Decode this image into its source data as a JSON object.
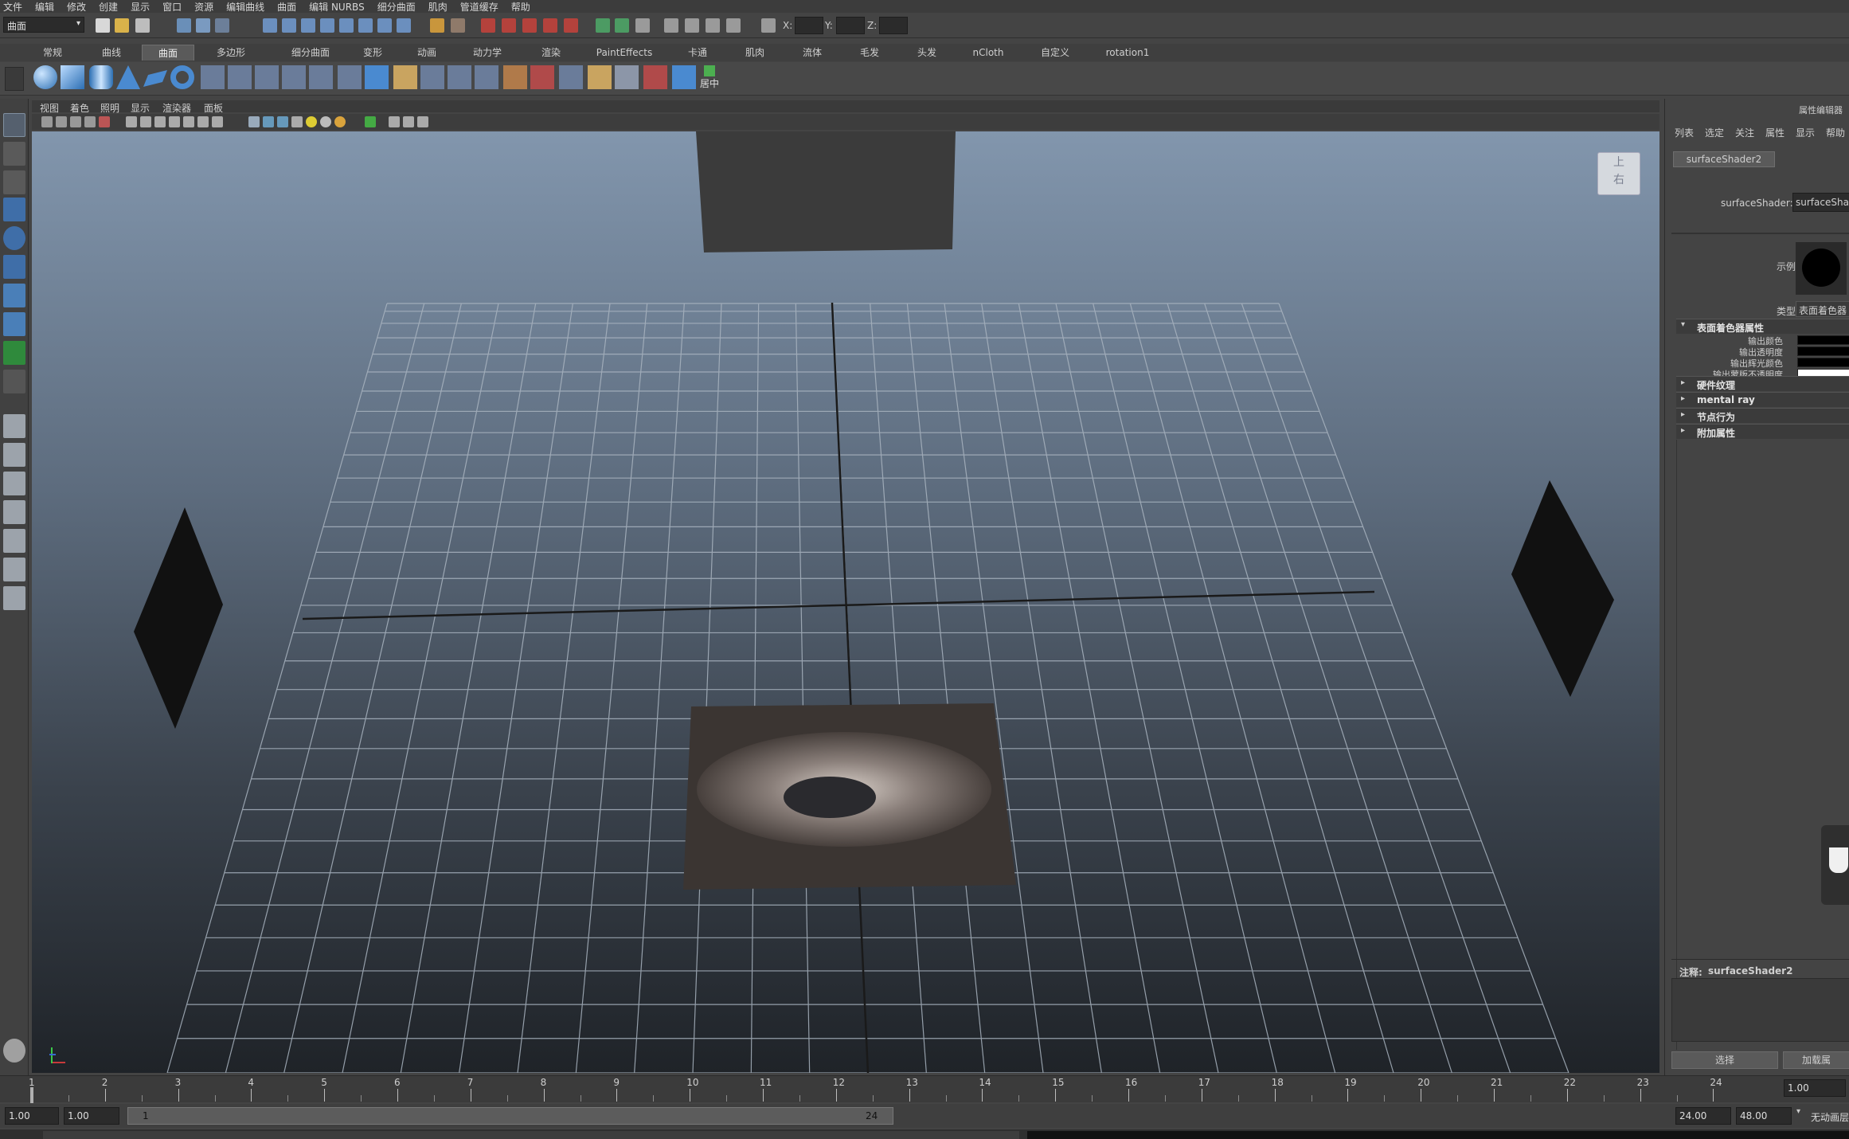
{
  "menubar": {
    "items": [
      "文件",
      "编辑",
      "修改",
      "创建",
      "显示",
      "窗口",
      "资源",
      "编辑曲线",
      "曲面",
      "编辑 NURBS",
      "细分曲面",
      "肌肉",
      "管道缓存",
      "帮助"
    ]
  },
  "statusline": {
    "menuset": "曲面",
    "x_label": "X:",
    "y_label": "Y:",
    "z_label": "Z:"
  },
  "shelf": {
    "tabs": [
      "常规",
      "曲线",
      "曲面",
      "多边形",
      "细分曲面",
      "变形",
      "动画",
      "动力学",
      "渲染",
      "PaintEffects",
      "卡通",
      "肌肉",
      "流体",
      "毛发",
      "头发",
      "nCloth",
      "自定义",
      "rotation1"
    ],
    "active_tab": "曲面",
    "last_icon_label": "居中"
  },
  "viewport": {
    "menu": [
      "视图",
      "着色",
      "照明",
      "显示",
      "渲染器",
      "面板"
    ],
    "viewcube_top": "上",
    "viewcube_side": "右",
    "colors": {
      "sky_top": "#8296ad",
      "floor": "#1f2328",
      "grid": "#a9b4c0"
    }
  },
  "attribute_editor": {
    "title": "属性编辑器",
    "menu": [
      "列表",
      "选定",
      "关注",
      "属性",
      "显示",
      "帮助"
    ],
    "node_tab": "surfaceShader2",
    "node_label": "surfaceShader:",
    "node_value": "surfaceShade",
    "sample_label": "示例",
    "type_label": "类型",
    "type_value": "表面着色器",
    "section_main": "表面着色器属性",
    "rows": [
      {
        "label": "输出颜色",
        "color": "#000000"
      },
      {
        "label": "输出透明度",
        "color": "#000000"
      },
      {
        "label": "输出辉光颜色",
        "color": "#000000"
      },
      {
        "label": "输出蒙版不透明度",
        "color": "#ffffff"
      }
    ],
    "sections": [
      "硬件纹理",
      "mental ray",
      "节点行为",
      "附加属性"
    ],
    "notes_label": "注释:",
    "notes_value": "surfaceShader2",
    "btn_select": "选择",
    "btn_load": "加载属"
  },
  "timeline": {
    "ticks": [
      "1",
      "2",
      "3",
      "4",
      "5",
      "6",
      "7",
      "8",
      "9",
      "10",
      "11",
      "12",
      "13",
      "14",
      "15",
      "16",
      "17",
      "18",
      "19",
      "20",
      "21",
      "22",
      "23",
      "24"
    ],
    "current": "1.00"
  },
  "rangebar": {
    "start": "1.00",
    "anim_start": "1.00",
    "slider_start": "1",
    "slider_end": "24",
    "anim_end": "24.00",
    "end": "48.00",
    "char_set": "无动画层"
  }
}
